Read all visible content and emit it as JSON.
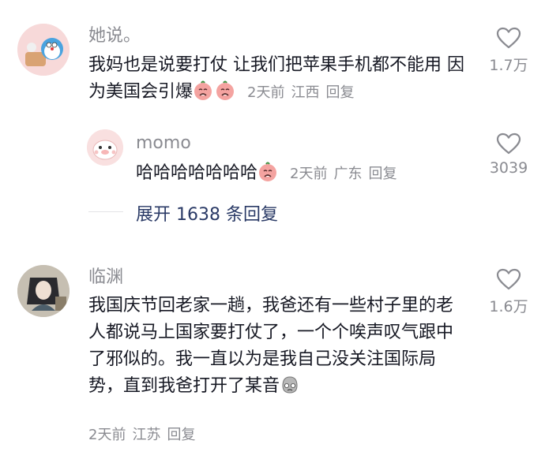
{
  "comments": [
    {
      "author": "她说。",
      "text": "我妈也是说要打仗  让我们把苹果手机都不能用  因为美国会引爆",
      "emoji": [
        "crying-face-emoji",
        "crying-face-emoji"
      ],
      "time": "2天前",
      "location": "江西",
      "reply_label": "回复",
      "likes": "1.7万",
      "replies": [
        {
          "author": "momo",
          "text": "哈哈哈哈哈哈哈",
          "emoji": [
            "crying-face-emoji"
          ],
          "time": "2天前",
          "location": "广东",
          "reply_label": "回复",
          "likes": "3039"
        }
      ],
      "expand_label": "展开 1638 条回复"
    },
    {
      "author": "临渊",
      "text": "我国庆节回老家一趟，我爸还有一些村子里的老人都说马上国家要打仗了，一个个唉声叹气跟中了邪似的。我一直以为是我自己没关注国际局势，直到我爸打开了某音",
      "emoji": [
        "pensive-face-emoji"
      ],
      "time": "2天前",
      "location": "江苏",
      "reply_label": "回复",
      "likes": "1.6万"
    }
  ],
  "colors": {
    "meta": "#8a8b91",
    "text": "#161823",
    "link": "#2a3a66"
  }
}
